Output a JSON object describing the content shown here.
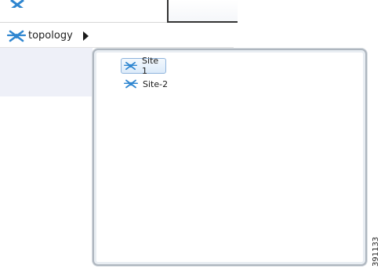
{
  "breadcrumb": {
    "label": "topology",
    "icon": "topology-icon"
  },
  "dropdown": {
    "items": [
      {
        "label": "Site 1",
        "icon": "site-icon",
        "selected": true
      },
      {
        "label": "Site-2",
        "icon": "site-icon",
        "selected": false
      }
    ]
  },
  "figure_id": "391133",
  "colors": {
    "icon_blue": "#2f86d0",
    "selection_border": "#8fb4dc",
    "dropdown_border": "#aeb6bf"
  }
}
